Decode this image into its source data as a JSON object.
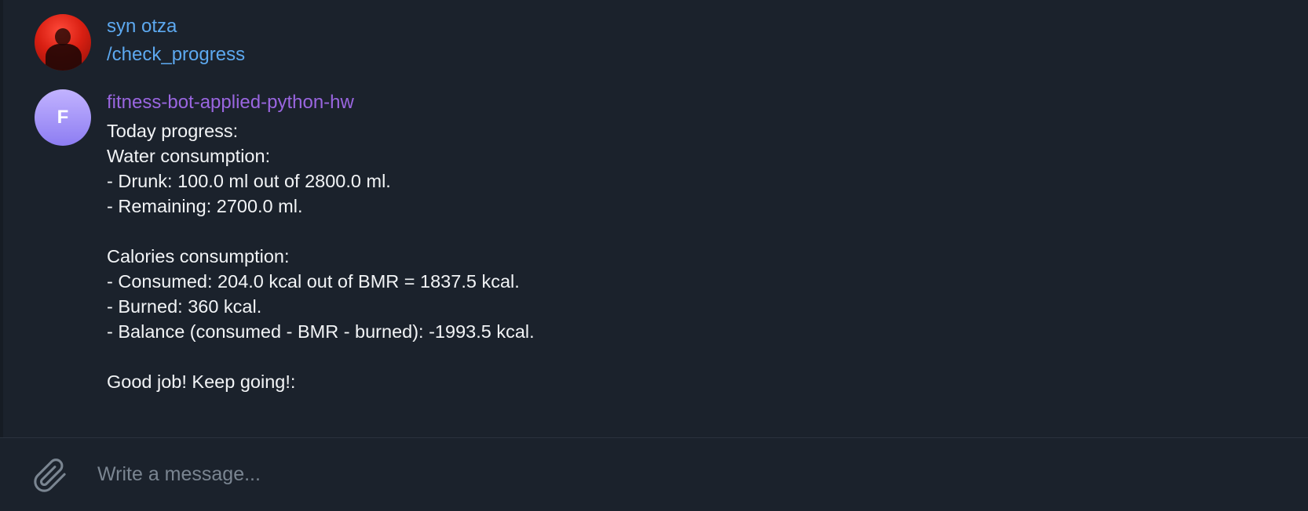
{
  "messages": {
    "user": {
      "sender": "syn otza",
      "text": "/check_progress"
    },
    "bot": {
      "sender": "fitness-bot-applied-python-hw",
      "avatar_letter": "F",
      "lines": [
        "Today progress:",
        "Water consumption:",
        "- Drunk: 100.0 ml out of 2800.0 ml.",
        "- Remaining: 2700.0 ml.",
        "",
        "Calories consumption:",
        "- Consumed: 204.0 kcal out of BMR = 1837.5 kcal.",
        "- Burned: 360 kcal.",
        "- Balance (consumed - BMR - burned): -1993.5 kcal.",
        "",
        "Good job! Keep going!:"
      ]
    }
  },
  "composer": {
    "placeholder": "Write a message...",
    "value": "",
    "attach_icon": "paperclip-icon"
  },
  "colors": {
    "background": "#1b222c",
    "user_name": "#5da9f0",
    "bot_name": "#9a66e0",
    "text": "#f2f4f6",
    "placeholder": "#7a8591"
  }
}
